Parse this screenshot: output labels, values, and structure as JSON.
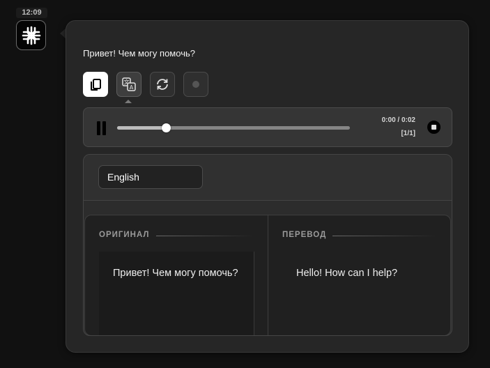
{
  "header": {
    "time": "12:09"
  },
  "assistant": {
    "avatar_icon": "snowflake-logo-icon"
  },
  "message": {
    "text": "Привет! Чем могу помочь?"
  },
  "actions": {
    "copy_icon": "copy-icon",
    "translate_icon": "translate-icon",
    "regenerate_icon": "refresh-icon",
    "record_icon": "record-icon"
  },
  "player": {
    "time": "0:00 / 0:02",
    "segment": "[1/1]",
    "progress": 0.21
  },
  "translation": {
    "language": "English",
    "original_label": "ОРИГИНАЛ",
    "translated_label": "ПЕРЕВОД",
    "original_text": "Привет! Чем могу помочь?",
    "translated_text": "Hello! How can I help?"
  },
  "colors": {
    "background": "#111111",
    "bubble": "#262626",
    "accent_active": "#ffffff"
  }
}
